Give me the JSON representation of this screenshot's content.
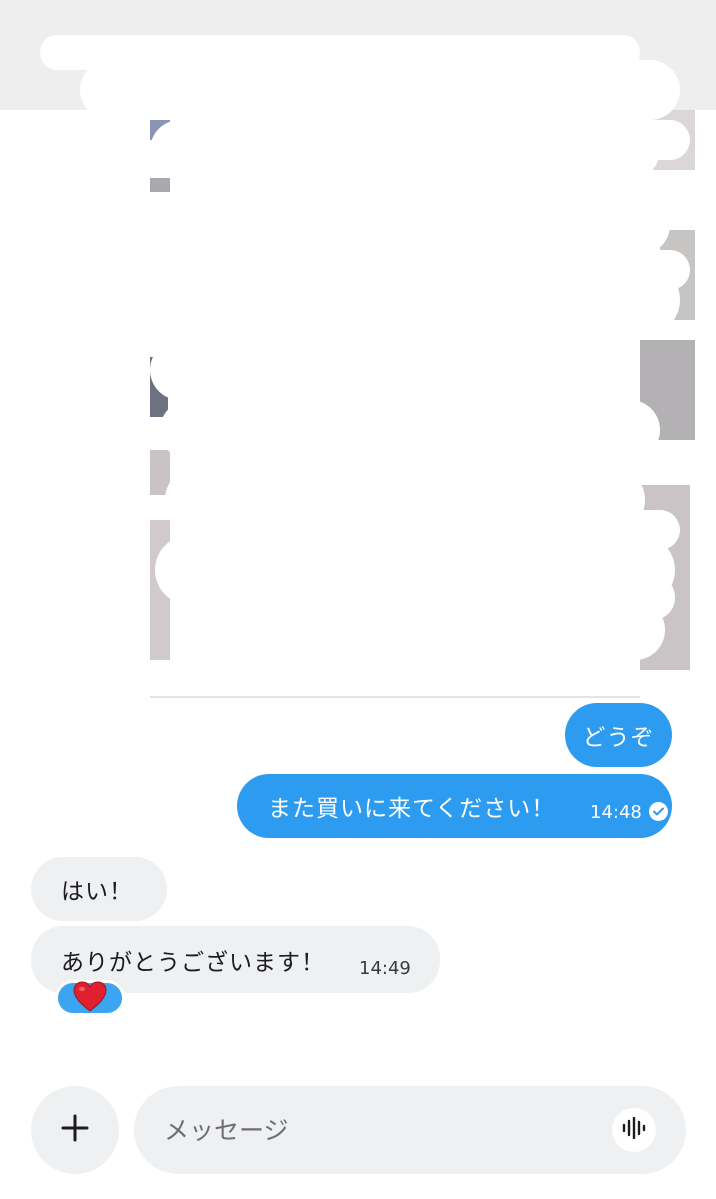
{
  "messages": [
    {
      "direction": "outgoing",
      "text": "どうぞ"
    },
    {
      "direction": "outgoing",
      "text": "また買いに来てください！",
      "time": "14:48",
      "status": "read-check-icon"
    },
    {
      "direction": "incoming",
      "text": "はい！"
    },
    {
      "direction": "incoming",
      "text": "ありがとうございます！",
      "time": "14:49",
      "reaction": "red-heart-icon"
    }
  ],
  "composer": {
    "placeholder": "メッセージ",
    "add_icon": "plus-icon",
    "voice_icon": "voice-waveform-icon"
  },
  "colors": {
    "outgoing_bubble": "#2d9cf0",
    "incoming_bubble": "#eef0f2",
    "reaction_bg": "#3ba5f1",
    "heart": "#e0202e"
  }
}
